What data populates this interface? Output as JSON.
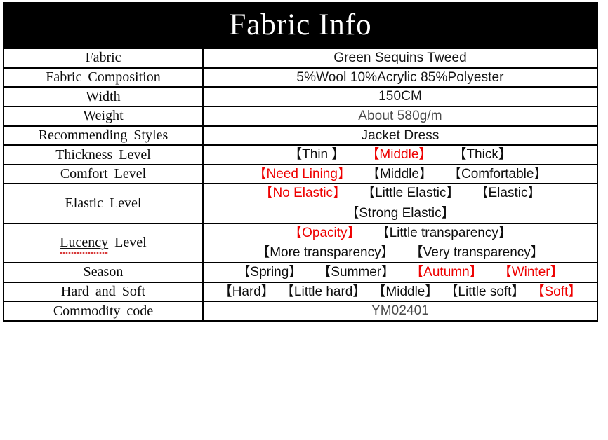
{
  "header": {
    "title": "Fabric Info",
    "background_color": "#000000",
    "text_color": "#ffffff"
  },
  "colors": {
    "highlight_red": "#ee0000",
    "text_black": "#0d0d0d",
    "muted_gray": "#4a4a4a",
    "border": "#000000"
  },
  "brackets": {
    "open": "【",
    "close": "】"
  },
  "rows": [
    {
      "label": "Fabric",
      "type": "text",
      "value": "Green Sequins Tweed",
      "muted": false
    },
    {
      "label": "Fabric Composition",
      "type": "text",
      "value": "5%Wool 10%Acrylic 85%Polyester",
      "muted": false
    },
    {
      "label": "Width",
      "type": "text",
      "value": "150CM",
      "muted": false
    },
    {
      "label": "Weight",
      "type": "text",
      "value": "About 580g/m",
      "muted": true
    },
    {
      "label": "Recommending Styles",
      "type": "text",
      "value": "Jacket Dress",
      "muted": false
    },
    {
      "label": "Thickness Level",
      "type": "options",
      "lines": [
        [
          {
            "text": "Thin ",
            "selected": false
          },
          {
            "text": "Middle",
            "selected": true
          },
          {
            "text": "Thick",
            "selected": false
          }
        ]
      ]
    },
    {
      "label": "Comfort Level",
      "type": "options",
      "lines": [
        [
          {
            "text": "Need Lining",
            "selected": true
          },
          {
            "text": "Middle",
            "selected": false
          },
          {
            "text": "Comfortable",
            "selected": false
          }
        ]
      ]
    },
    {
      "label": "Elastic Level",
      "type": "options",
      "lines": [
        [
          {
            "text": "No Elastic",
            "selected": true
          },
          {
            "text": "Little Elastic",
            "selected": false
          },
          {
            "text": "Elastic",
            "selected": false
          }
        ],
        [
          {
            "text": "Strong Elastic",
            "selected": false
          }
        ]
      ]
    },
    {
      "label": "Lucency Level",
      "label_misspelled_word": "Lucency",
      "label_rest": " Level",
      "type": "options",
      "lines": [
        [
          {
            "text": "Opacity",
            "selected": true
          },
          {
            "text": "Little transparency",
            "selected": false
          }
        ],
        [
          {
            "text": "More transparency",
            "selected": false
          },
          {
            "text": "Very transparency",
            "selected": false
          }
        ]
      ]
    },
    {
      "label": "Season",
      "type": "options",
      "lines": [
        [
          {
            "text": "Spring",
            "selected": false
          },
          {
            "text": "Summer",
            "selected": false
          },
          {
            "text": "Autumn",
            "selected": true
          },
          {
            "text": "Winter",
            "selected": true
          }
        ]
      ]
    },
    {
      "label": "Hard and Soft",
      "type": "options",
      "lines": [
        [
          {
            "text": "Hard",
            "selected": false
          },
          {
            "text": "Little hard",
            "selected": false
          },
          {
            "text": "Middle",
            "selected": false
          },
          {
            "text": "Little soft",
            "selected": false
          },
          {
            "text": "Soft",
            "selected": true
          }
        ]
      ]
    },
    {
      "label": "Commodity code",
      "type": "text",
      "value": "YM02401",
      "muted": true
    }
  ]
}
